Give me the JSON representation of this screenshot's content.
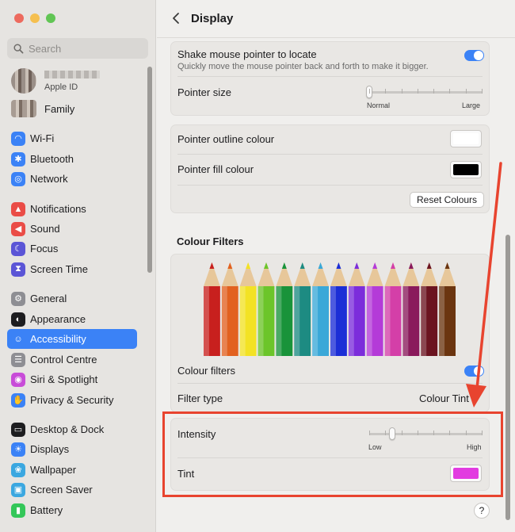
{
  "window": {
    "title": "Display"
  },
  "search": {
    "placeholder": "Search"
  },
  "account": {
    "subtitle": "Apple ID",
    "family_label": "Family"
  },
  "sidebar": {
    "items": [
      {
        "label": "Wi-Fi",
        "icon": "wifi-icon",
        "color": "#3b82f6"
      },
      {
        "label": "Bluetooth",
        "icon": "bluetooth-icon",
        "color": "#3b82f6"
      },
      {
        "label": "Network",
        "icon": "network-icon",
        "color": "#3b82f6"
      },
      {
        "label": "Notifications",
        "icon": "bell-icon",
        "color": "#ea4c46"
      },
      {
        "label": "Sound",
        "icon": "speaker-icon",
        "color": "#ea4c46"
      },
      {
        "label": "Focus",
        "icon": "moon-icon",
        "color": "#5b55d6"
      },
      {
        "label": "Screen Time",
        "icon": "hourglass-icon",
        "color": "#5b55d6"
      },
      {
        "label": "General",
        "icon": "gear-icon",
        "color": "#8e8e93"
      },
      {
        "label": "Appearance",
        "icon": "appearance-icon",
        "color": "#1d1d1f"
      },
      {
        "label": "Accessibility",
        "icon": "accessibility-icon",
        "color": "#3b82f6"
      },
      {
        "label": "Control Centre",
        "icon": "control-centre-icon",
        "color": "#8e8e93"
      },
      {
        "label": "Siri & Spotlight",
        "icon": "siri-icon",
        "color": "#c84cd8"
      },
      {
        "label": "Privacy & Security",
        "icon": "hand-icon",
        "color": "#3b82f6"
      },
      {
        "label": "Desktop & Dock",
        "icon": "dock-icon",
        "color": "#1d1d1f"
      },
      {
        "label": "Displays",
        "icon": "displays-icon",
        "color": "#3b82f6"
      },
      {
        "label": "Wallpaper",
        "icon": "wallpaper-icon",
        "color": "#3ba7e0"
      },
      {
        "label": "Screen Saver",
        "icon": "screensaver-icon",
        "color": "#3ba7e0"
      },
      {
        "label": "Battery",
        "icon": "battery-icon",
        "color": "#34c759"
      }
    ],
    "active": "Accessibility"
  },
  "pointer": {
    "shake_label": "Shake mouse pointer to locate",
    "shake_desc": "Quickly move the mouse pointer back and forth to make it bigger.",
    "shake_on": true,
    "size_label": "Pointer size",
    "size_min": "Normal",
    "size_max": "Large",
    "size_level": 0.0
  },
  "colours": {
    "outline_label": "Pointer outline colour",
    "outline_color": "#ffffff",
    "fill_label": "Pointer fill colour",
    "fill_color": "#000000",
    "reset_label": "Reset Colours"
  },
  "filters": {
    "section_title": "Colour Filters",
    "toggle_label": "Colour filters",
    "toggle_on": true,
    "type_label": "Filter type",
    "type_value": "Colour Tint",
    "intensity_label": "Intensity",
    "intensity_min": "Low",
    "intensity_max": "High",
    "intensity_level": 0.2,
    "tint_label": "Tint",
    "tint_color": "#e23be0",
    "pencil_colors": [
      "#c8201e",
      "#e2611f",
      "#f3e224",
      "#6cc52a",
      "#19933a",
      "#1d8b82",
      "#3aa8d8",
      "#1b2ed6",
      "#7c2ddb",
      "#b43bd8",
      "#d43fa8",
      "#8a1a5c",
      "#6b1420",
      "#6b3510"
    ]
  },
  "help": {
    "label": "?"
  }
}
